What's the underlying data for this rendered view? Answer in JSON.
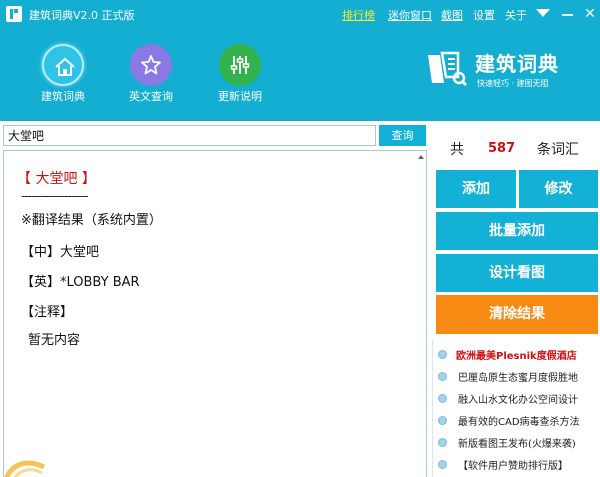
{
  "app": {
    "title": "建筑词典V2.0 正式版",
    "menu": {
      "ranking": "排行榜",
      "mini": "迷你窗口",
      "screenshot": "截图",
      "settings": "设置",
      "about": "关于"
    },
    "close_glyph": "✕"
  },
  "nav": [
    {
      "label": "建筑词典",
      "icon": "home-icon"
    },
    {
      "label": "英文查询",
      "icon": "star-icon"
    },
    {
      "label": "更新说明",
      "icon": "sliders-icon"
    }
  ],
  "brand": {
    "name": "建筑词典",
    "slogan": "快速轻巧 · 建图无阻"
  },
  "search": {
    "value": "大堂吧",
    "button_label": "查询"
  },
  "result": {
    "heading": "【 大堂吧 】",
    "rule": "--------------------",
    "lines": [
      "※翻译结果（系统内置）",
      "【中】大堂吧",
      "【英】*LOBBY BAR",
      "【注释】",
      "暂无内容"
    ]
  },
  "stats": {
    "prefix": "共",
    "count": "587",
    "suffix": "条词汇"
  },
  "actions": {
    "add": "添加",
    "edit": "修改",
    "batch_add": "批量添加",
    "view": "设计看图",
    "clear": "清除结果"
  },
  "news": [
    "欧洲最美Plesnik度假酒店",
    "巴厘岛原生态蜜月度假胜地",
    "融入山水文化办公空间设计",
    "最有效的CAD病毒查杀方法",
    "新版看图王发布(火爆来袭)",
    "【软件用户赞助排行版】"
  ],
  "colors": {
    "header": "#13aed1",
    "button": "#14b1d6",
    "clear_button": "#f78a12",
    "highlight": "#f9ef25",
    "result_heading": "#cc1010"
  }
}
